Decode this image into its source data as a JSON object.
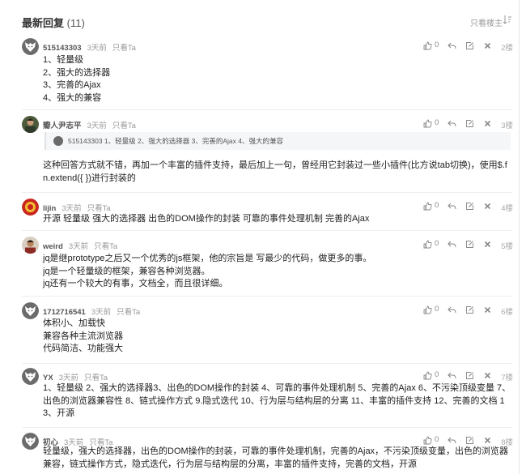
{
  "header": {
    "title": "最新回复",
    "count": "(11)",
    "only_op_label": "只看楼主"
  },
  "only_ta_label": "只看Ta",
  "replies": [
    {
      "username": "515143303",
      "time": "3天前",
      "likes": "0",
      "floor": "2楼",
      "avatar": "wolf-avatar",
      "lines": [
        "1、轻量级",
        "2、强大的选择器",
        "3、完善的Ajax",
        "4、强大的兼容"
      ]
    },
    {
      "username": "瓣人尹志平",
      "time": "3天前",
      "likes": "0",
      "floor": "3楼",
      "avatar": "person-avatar",
      "quote": {
        "username": "515143303",
        "text": "1、轻量级 2、强大的选择器 3、完善的Ajax 4、强大的兼容"
      },
      "lines": [
        "这种回答方式就不错，再加一个丰富的插件支持，最后加上一句，曾经用它封装过一些小插件(比方说tab切换)，使用$.fn.extend({ })进行封装的"
      ]
    },
    {
      "username": "lijin",
      "time": "3天前",
      "likes": "0",
      "floor": "4楼",
      "avatar": "emblem-avatar",
      "lines": [
        "开源  轻量级  强大的选择器  出色的DOM操作的封装   可靠的事件处理机制   完善的Ajax"
      ]
    },
    {
      "username": "weird",
      "time": "3天前",
      "likes": "0",
      "floor": "5楼",
      "avatar": "person2-avatar",
      "lines": [
        "jq是继prototype之后又一个优秀的js框架，他的宗旨是 写最少的代码，做更多的事。",
        "jq是一个轻量级的框架，兼容各种浏览器。",
        "jq还有一个较大的有事，文档全，而且很详细。"
      ]
    },
    {
      "username": "1712716541",
      "time": "3天前",
      "likes": "0",
      "floor": "6楼",
      "avatar": "wolf-avatar",
      "lines": [
        " 体积小、加载快",
        "兼容各种主流浏览器",
        "代码简洁、功能强大"
      ]
    },
    {
      "username": "YX",
      "time": "3天前",
      "likes": "0",
      "floor": "7楼",
      "avatar": "wolf-avatar",
      "lines": [
        " 1、轻量级  2、强大的选择器3、出色的DOM操作的封装  4、可靠的事件处理机制  5、完善的Ajax  6、不污染顶级变量   7、出色的浏览器兼容性  8、链式操作方式  9.隐式迭代  10、行为层与结构层的分离   11、丰富的插件支持   12、完善的文档   13、开源"
      ]
    },
    {
      "username": "初心",
      "time": "3天前",
      "likes": "0",
      "floor": "8楼",
      "avatar": "wolf-avatar",
      "lines": [
        "轻量级，强大的选择器，出色的DOM操作的封装，可靠的事件处理机制，完善的Ajax，不污染顶级变量，出色的浏览器兼容，链式操作方式，隐式迭代，行为层与结构层的分离，丰富的插件支持，完善的文档，开源"
      ]
    }
  ]
}
